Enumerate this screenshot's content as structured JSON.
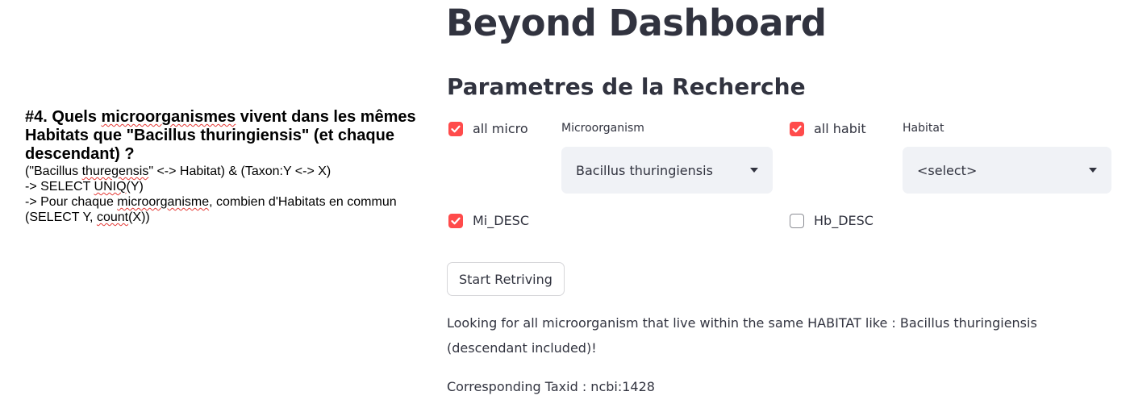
{
  "note": {
    "heading_prefix": "#4. Quels ",
    "heading_word": "microorganismes",
    "heading_rest": " vivent dans les mêmes Habitats que \"Bacillus thuringiensis\" (et chaque descendant) ?",
    "line1_a": "(\"Bacillus ",
    "line1_word": "thuregensis",
    "line1_b": "\" <-> Habitat) & (Taxon:Y <-> X)",
    "line2_a": "-> SELECT ",
    "line2_word": "UNIQ",
    "line2_b": "(Y)",
    "line3_a": "-> Pour chaque ",
    "line3_word": "microorganisme",
    "line3_b": ", combien d'Habitats en commun (SELECT Y, ",
    "line3_word2": "count",
    "line3_c": "(X))"
  },
  "app": {
    "title": "Beyond Dashboard",
    "section_title": "Parametres de la Recherche",
    "all_micro": {
      "label": "all micro",
      "checked": true
    },
    "microorganism": {
      "label": "Microorganism",
      "value": "Bacillus thuringiensis"
    },
    "all_habit": {
      "label": "all habit",
      "checked": true
    },
    "habitat": {
      "label": "Habitat",
      "value": "<select>"
    },
    "mi_desc": {
      "label": "Mi_DESC",
      "checked": true
    },
    "hb_desc": {
      "label": "Hb_DESC",
      "checked": false
    },
    "start_button": "Start Retriving",
    "result_message": "Looking for all microorganism that live within the same HABITAT like : Bacillus thuringiensis (descendant included)!",
    "taxid_line": "Corresponding Taxid : ncbi:1428"
  },
  "colors": {
    "accent": "#ff4b4b",
    "text": "#31333f",
    "select_bg": "#f0f2f6",
    "spellcheck": "#e53935"
  },
  "icons": {
    "check": "check-icon",
    "dropdown": "chevron-down-icon"
  }
}
